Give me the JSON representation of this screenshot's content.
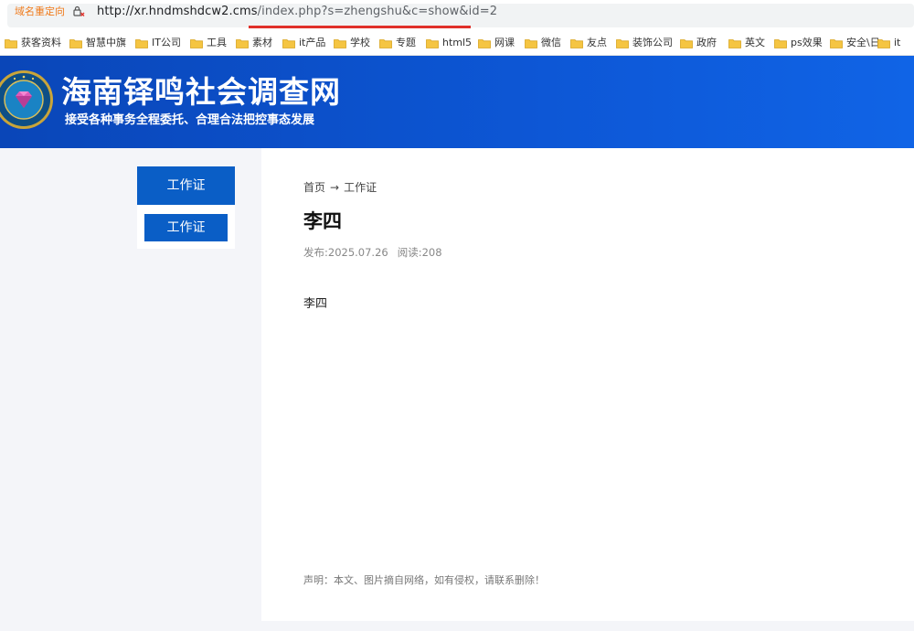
{
  "browser": {
    "redirect_label": "域名重定向",
    "url_host": "http://xr.hndmshdcw2.cms",
    "url_path": "/index.php?s=zhengshu&c=show&id=2"
  },
  "bookmarks": [
    {
      "label": "获客资料"
    },
    {
      "label": "智慧中旗"
    },
    {
      "label": "IT公司"
    },
    {
      "label": "工具"
    },
    {
      "label": "素材"
    },
    {
      "label": "it产品"
    },
    {
      "label": "学校"
    },
    {
      "label": "专题"
    },
    {
      "label": "html5"
    },
    {
      "label": "网课"
    },
    {
      "label": "微信"
    },
    {
      "label": "友点"
    },
    {
      "label": "装饰公司"
    },
    {
      "label": "政府"
    },
    {
      "label": "英文"
    },
    {
      "label": "ps效果"
    },
    {
      "label": "安全\\日"
    },
    {
      "label": "it"
    }
  ],
  "header": {
    "title": "海南铎鸣社会调查网",
    "slogan": "接受各种事务全程委托、合理合法把控事态发展"
  },
  "sidebar": {
    "heading": "工作证",
    "items": [
      {
        "label": "工作证"
      }
    ]
  },
  "article": {
    "breadcrumb": [
      "首页",
      "工作证"
    ],
    "title": "李四",
    "published": "发布:2025.07.26",
    "reads": "阅读:208",
    "body": "李四",
    "disclaimer": "声明：本文、图片摘自网络，如有侵权，请联系删除！"
  },
  "colors": {
    "banner": "#0d57d6",
    "sidebar_accent": "#0a5ec6",
    "url_underline": "#e0302a",
    "redirect_label": "#f07a1a"
  }
}
